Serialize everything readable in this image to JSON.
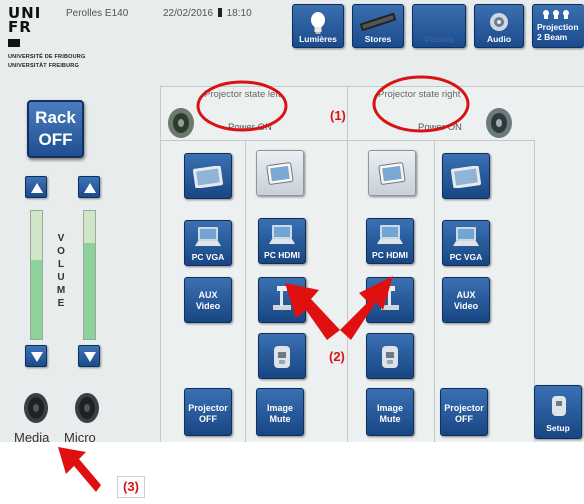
{
  "header": {
    "logo_line1": "UNI",
    "logo_line2": "FR",
    "logo_uni_fr": "UNIVERSITÉ DE FRIBOURG",
    "logo_uni_de": "UNIVERSITÄT FREIBURG",
    "room": "Perolles E140",
    "date": "22/02/2016",
    "time": "18:10",
    "buttons": [
      {
        "label": "Lumières",
        "icon": "bulb-icon"
      },
      {
        "label": "Stores",
        "icon": "blinds-icon"
      },
      {
        "label": "Visuals",
        "icon": "screen-icon"
      },
      {
        "label": "Audio",
        "icon": "audio-icon"
      },
      {
        "label": "Projection",
        "sublabel": "2 Beam",
        "icon": "projector-icon"
      }
    ]
  },
  "left_panel": {
    "rack_line1": "Rack",
    "rack_line2": "OFF",
    "volume_letters": [
      "V",
      "O",
      "L",
      "U",
      "M",
      "E"
    ],
    "media_level": 0.62,
    "micro_level": 0.75,
    "media_label": "Media",
    "micro_label": "Micro"
  },
  "main": {
    "state_left": "Projector state left",
    "state_right": "Projector state right",
    "power_left": "Power ON",
    "power_right": "Power ON",
    "left_col": [
      {
        "label": "",
        "icon": "tablet-icon"
      },
      {
        "label": "PC VGA",
        "icon": "laptop-icon"
      },
      {
        "label": "AUX\nVideo",
        "icon": ""
      },
      {
        "label": "Projector\nOFF",
        "icon": ""
      }
    ],
    "center_left_col": [
      {
        "label": "",
        "icon": "tablet-icon",
        "selected": true
      },
      {
        "label": "PC HDMI",
        "icon": "laptop-icon"
      },
      {
        "label": "",
        "icon": "document-camera-icon"
      },
      {
        "label": "",
        "icon": "plug-icon"
      },
      {
        "label": "Image\nMute",
        "icon": ""
      }
    ],
    "center_right_col": [
      {
        "label": "",
        "icon": "tablet-icon",
        "selected": true
      },
      {
        "label": "PC HDMI",
        "icon": "laptop-icon"
      },
      {
        "label": "",
        "icon": "document-camera-icon"
      },
      {
        "label": "",
        "icon": "plug-icon"
      },
      {
        "label": "Image\nMute",
        "icon": ""
      }
    ],
    "right_col": [
      {
        "label": "",
        "icon": "tablet-icon"
      },
      {
        "label": "PC VGA",
        "icon": "laptop-icon"
      },
      {
        "label": "AUX\nVideo",
        "icon": ""
      },
      {
        "label": "Projector\nOFF",
        "icon": ""
      }
    ],
    "setup_label": "Setup"
  },
  "annotations": {
    "one": "(1)",
    "two": "(2)",
    "three": "(3)",
    "color": "#d81313"
  }
}
